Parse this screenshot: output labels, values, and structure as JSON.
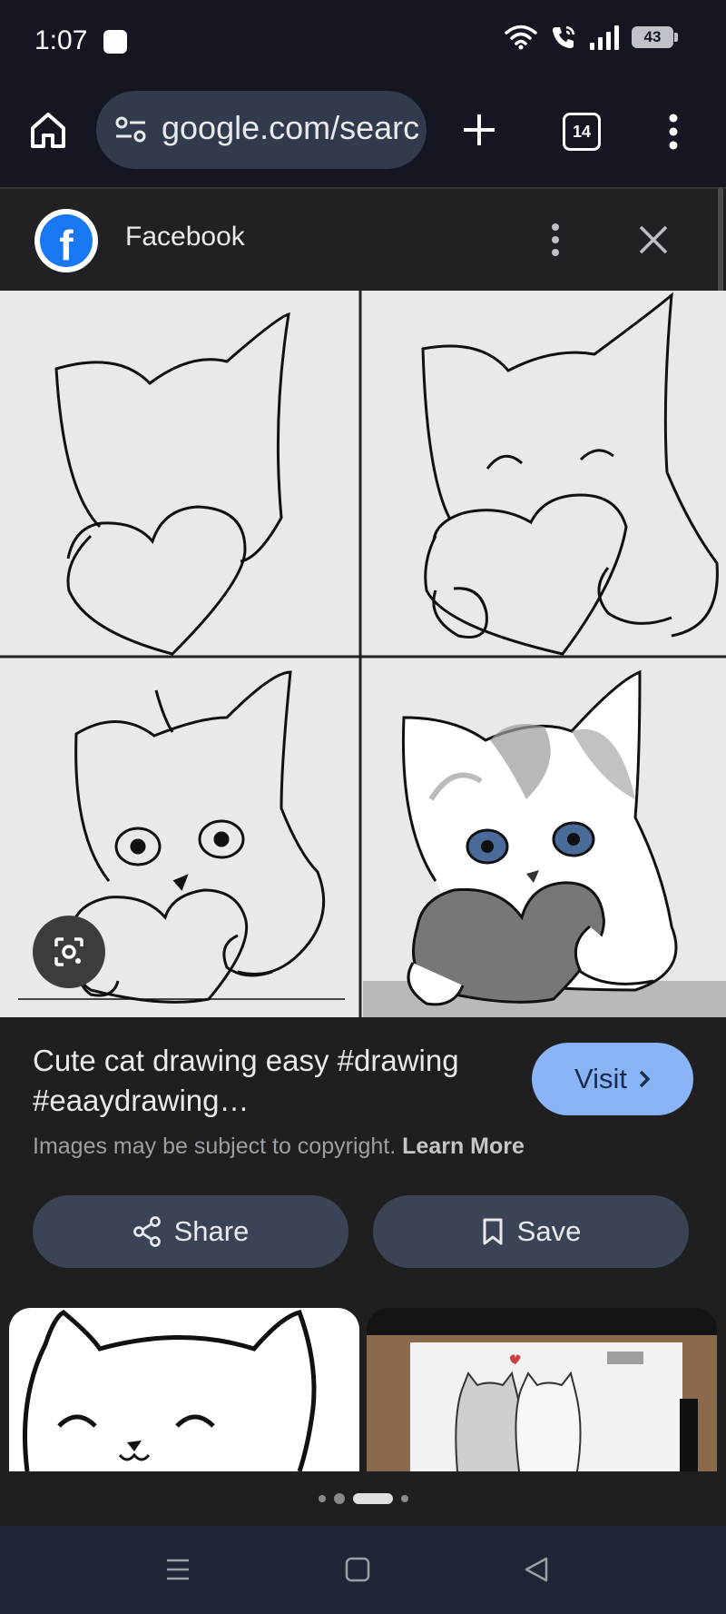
{
  "status_bar": {
    "time": "1:07",
    "battery": "43"
  },
  "browser": {
    "url": "google.com/searc",
    "tab_count": "14"
  },
  "source": {
    "name": "Facebook",
    "logo_letter": "f"
  },
  "result": {
    "title": "Cute cat drawing easy #drawing #eaaydrawing…",
    "visit_label": "Visit",
    "copyright_text": "Images may be subject to copyright.",
    "learn_more": "Learn More",
    "share_label": "Share",
    "save_label": "Save"
  },
  "icons": {
    "home": "home-icon",
    "tune": "tune-icon",
    "add": "plus-icon",
    "more": "more-vert-icon",
    "close": "close-icon",
    "lens": "lens-icon",
    "share": "share-icon",
    "bookmark": "bookmark-icon",
    "recents": "recents-icon",
    "home_nav": "home-square-icon",
    "back": "back-triangle-icon"
  },
  "pager": {
    "count": 4,
    "active_index": 2
  },
  "colors": {
    "accent": "#8ab4f8",
    "toolbar": "#141722",
    "surface": "#1f1f1f",
    "button": "#3b4456",
    "facebook": "#1877f2"
  }
}
